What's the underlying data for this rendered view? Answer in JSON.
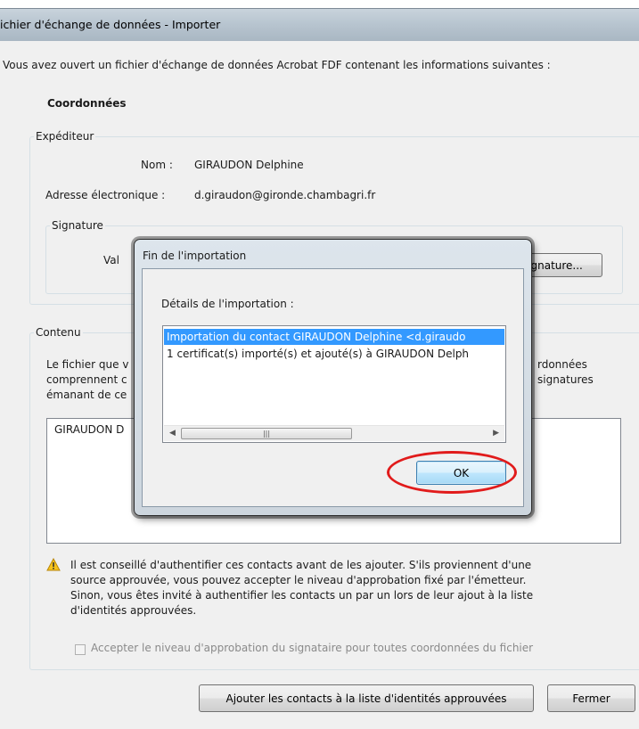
{
  "window": {
    "title": "ichier d'échange de données - Importer"
  },
  "intro": "Vous avez ouvert un fichier d'échange de données Acrobat FDF contenant les informations suivantes :",
  "section_title": "Coordonnées",
  "sender": {
    "legend": "Expéditeur",
    "name_label": "Nom :",
    "name_value": "GIRAUDON Delphine",
    "email_label": "Adresse électronique :",
    "email_value": "d.giraudon@gironde.chambagri.fr",
    "signature": {
      "legend": "Signature",
      "validity_label": "Val",
      "button_label": "Propriétés de la signature..."
    }
  },
  "contents": {
    "legend": "Contenu",
    "description_lines": [
      "Le fichier que v",
      "comprennent c",
      "émanant de ce"
    ],
    "description_right_lines": [
      "rdonnées",
      "signatures"
    ],
    "list_items": [
      "GIRAUDON D"
    ]
  },
  "warning": {
    "lines": [
      "Il est conseillé d'authentifier ces contacts avant de les ajouter. S'ils proviennent d'une",
      "source approuvée, vous pouvez accepter le niveau d'approbation fixé par l'émetteur.",
      "Sinon, vous êtes invité à authentifier les contacts un par un lors de leur ajout à la liste",
      "d'identités approuvées."
    ],
    "checkbox_label": "Accepter le niveau d'approbation du signataire pour toutes coordonnées du fichier",
    "checkbox_checked": false
  },
  "buttons": {
    "add_contacts": "Ajouter les contacts à la liste d'identités approuvées",
    "close": "Fermer"
  },
  "modal": {
    "title": "Fin de l'importation",
    "details_label": "Détails de l'importation :",
    "items": [
      "Importation du contact GIRAUDON Delphine <d.giraudo",
      "1 certificat(s) importé(s) et ajouté(s) à GIRAUDON Delph"
    ],
    "selected_index": 0,
    "ok_label": "OK"
  },
  "colors": {
    "selection": "#3399ff",
    "highlight_ring": "#e11b1b"
  }
}
